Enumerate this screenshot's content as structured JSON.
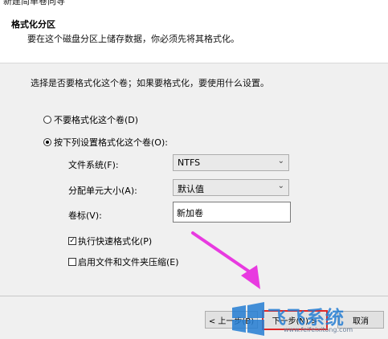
{
  "window": {
    "title": "新建简单卷向导"
  },
  "header": {
    "title": "格式化分区",
    "subtitle": "要在这个磁盘分区上储存数据，你必须先将其格式化。"
  },
  "description": "选择是否要格式化这个卷；如果要格式化，要使用什么设置。",
  "options": {
    "no_format": {
      "label": "不要格式化这个卷(D)",
      "selected": false
    },
    "format": {
      "label": "按下列设置格式化这个卷(O):",
      "selected": true
    }
  },
  "fields": {
    "filesystem": {
      "label": "文件系统(F):",
      "value": "NTFS"
    },
    "allocation": {
      "label": "分配单元大小(A):",
      "value": "默认值"
    },
    "volume_label": {
      "label": "卷标(V):",
      "value": "新加卷"
    }
  },
  "checkboxes": {
    "quick_format": {
      "label": "执行快速格式化(P)",
      "checked": true
    },
    "compression": {
      "label": "启用文件和文件夹压缩(E)",
      "checked": false
    }
  },
  "buttons": {
    "back": "< 上一步(B)",
    "next": "下一步(N) >",
    "cancel": "取消"
  },
  "watermark": {
    "text": "飞飞系统",
    "url": "www.feifeixitong.com"
  },
  "colors": {
    "annotation_arrow": "#e83ae0",
    "highlight_box": "#e02828",
    "watermark_blue": "#237dd2"
  },
  "icons": {
    "dropdown": "chevron-down-icon",
    "watermark_logo": "windows-logo-icon"
  }
}
